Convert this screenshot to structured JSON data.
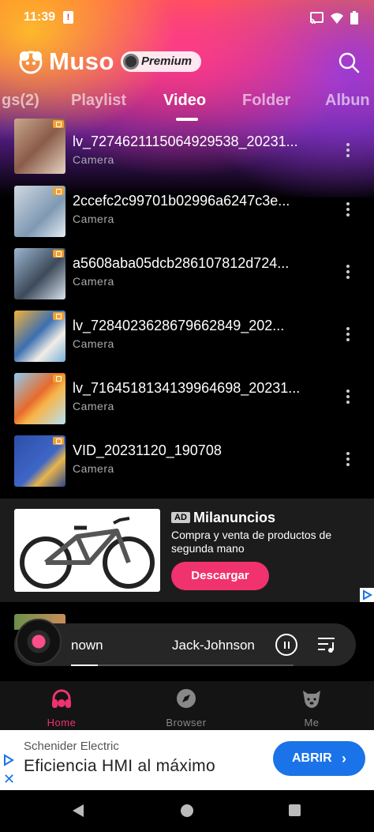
{
  "status_bar": {
    "time": "11:39"
  },
  "app": {
    "name": "Muso",
    "badge": "Premium"
  },
  "tabs": [
    {
      "label": "gs(2)",
      "active": false
    },
    {
      "label": "Playlist",
      "active": false
    },
    {
      "label": "Video",
      "active": true
    },
    {
      "label": "Folder",
      "active": false
    },
    {
      "label": "Albun",
      "active": false
    }
  ],
  "videos": [
    {
      "title": "lv_7274621115064929538_20231...",
      "folder": "Camera"
    },
    {
      "title": "2ccefc2c99701b02996a6247c3e...",
      "folder": "Camera"
    },
    {
      "title": "a5608aba05dcb286107812d724...",
      "folder": "Camera"
    },
    {
      "title": "lv_7284023628679662849_202...",
      "folder": "Camera"
    },
    {
      "title": "lv_7164518134139964698_20231...",
      "folder": "Camera"
    },
    {
      "title": "VID_20231120_190708",
      "folder": "Camera"
    }
  ],
  "ad": {
    "tag": "AD",
    "advertiser": "Milanuncios",
    "description": "Compra y venta de productos de segunda mano",
    "cta": "Descargar"
  },
  "player": {
    "title": "nown",
    "artist": "Jack-Johnson",
    "progress": 0.12
  },
  "bottom_nav": [
    {
      "label": "Home",
      "active": true
    },
    {
      "label": "Browser",
      "active": false
    },
    {
      "label": "Me",
      "active": false
    }
  ],
  "banner_ad": {
    "advertiser": "Schenider Electric",
    "headline": "Eficiencia HMI al máximo",
    "cta": "ABRIR"
  },
  "colors": {
    "accent": "#f0326e",
    "banner_button": "#1a73e8"
  }
}
